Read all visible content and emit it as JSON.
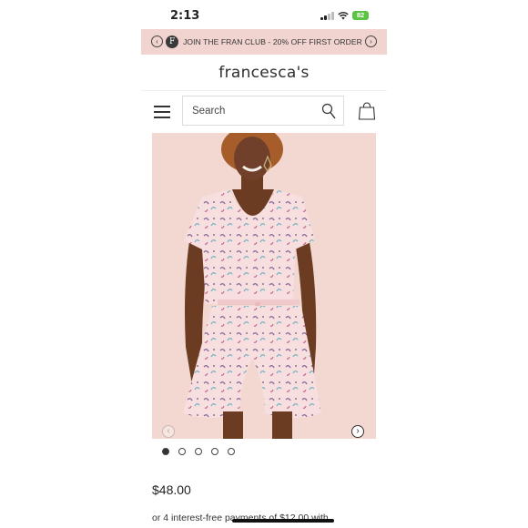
{
  "status_bar": {
    "time": "2:13",
    "battery": "82"
  },
  "promo": {
    "logo_letter": "F",
    "text": "JOIN THE FRAN CLUB - 20% OFF FIRST ORDER",
    "prev_icon": "chevron-left-icon",
    "next_icon": "chevron-right-icon"
  },
  "brand": {
    "name": "francesca's"
  },
  "nav": {
    "menu_icon": "hamburger-menu-icon",
    "search_placeholder": "Search",
    "search_icon": "magnifier-icon",
    "bag_icon": "shopping-bag-icon"
  },
  "product": {
    "carousel": {
      "total": 5,
      "active_index": 0
    },
    "price": "$48.00",
    "installments": "or 4 interest-free payments of $12.00 with"
  },
  "colors": {
    "promo_bg": "#f1d4cf",
    "photo_bg": "#f2d8d1",
    "battery": "#5ac341"
  }
}
